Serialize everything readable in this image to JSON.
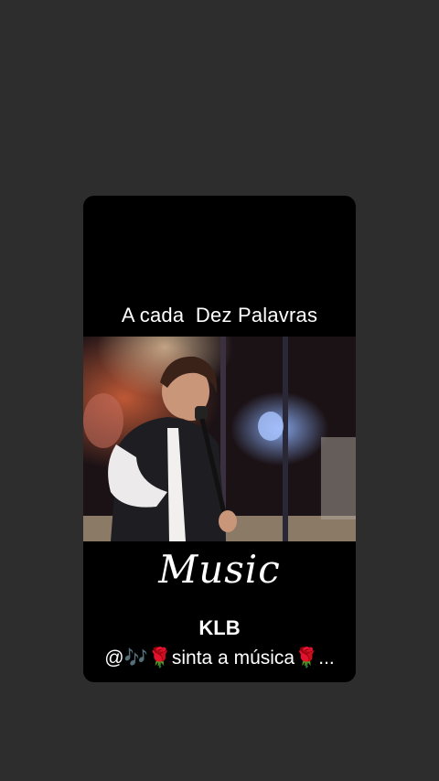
{
  "story": {
    "title": "A cada  Dez Palavras",
    "music_label": "Music",
    "artist": "KLB",
    "caption": "@🎶🌹sinta a música🌹..."
  },
  "colors": {
    "background": "#2e2d2e",
    "card": "#000000",
    "text": "#ffffff"
  },
  "icons": {
    "photo": "singer-photo"
  }
}
